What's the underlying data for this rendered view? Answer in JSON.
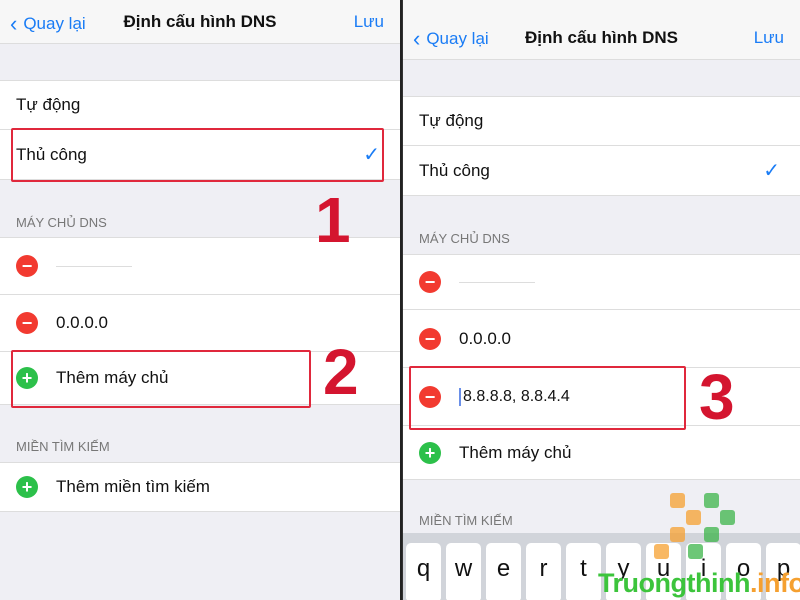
{
  "left": {
    "back": "Quay lại",
    "title": "Định cấu hình DNS",
    "save": "Lưu",
    "auto": "Tự động",
    "manual": "Thủ công",
    "dns_header": "MÁY CHỦ DNS",
    "servers": [
      "",
      "0.0.0.0"
    ],
    "add_server": "Thêm máy chủ",
    "search_header": "MIỀN TÌM KIẾM",
    "add_domain": "Thêm miền tìm kiếm",
    "step1": "1",
    "step2": "2"
  },
  "right": {
    "back": "Quay lại",
    "title": "Định cấu hình DNS",
    "save": "Lưu",
    "auto": "Tự động",
    "manual": "Thủ công",
    "dns_header": "MÁY CHỦ DNS",
    "servers": [
      "",
      "0.0.0.0"
    ],
    "editing_value": "8.8.8.8, 8.8.4.4",
    "add_server": "Thêm máy chủ",
    "search_header": "MIỀN TÌM KIẾM",
    "step3": "3",
    "keys": [
      "q",
      "w",
      "e",
      "r",
      "t",
      "y",
      "u",
      "i",
      "o",
      "p"
    ]
  },
  "watermark": {
    "main": "Truongthinh",
    "suffix": ".info"
  },
  "colors": {
    "accent": "#1a7cf5",
    "highlight": "#e0283c",
    "remove": "#f23a30",
    "add": "#2cc04a"
  }
}
